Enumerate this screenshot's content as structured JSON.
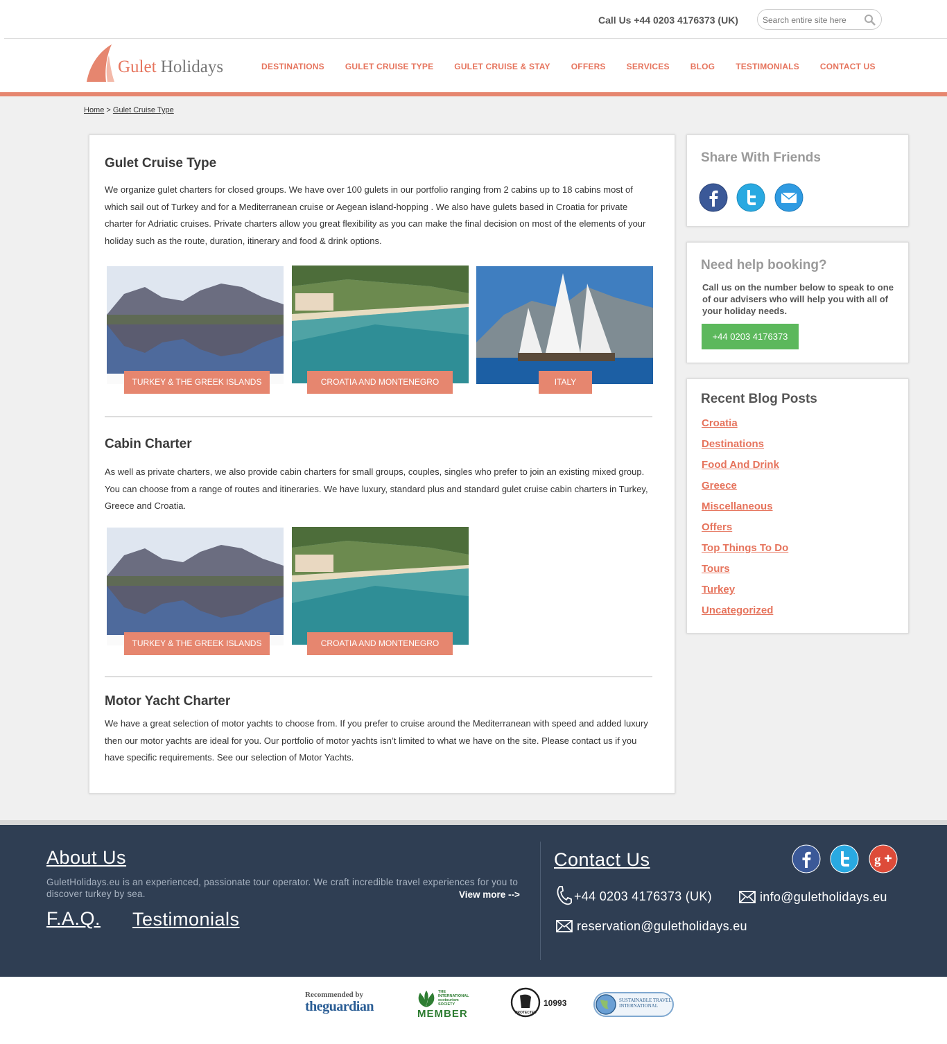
{
  "topbar": {
    "call": "Call Us +44 0203 4176373 (UK)",
    "search_placeholder": "Search entire site here"
  },
  "logo": {
    "brand_a": "Gulet",
    "brand_b": " Holidays"
  },
  "nav": [
    "DESTINATIONS",
    "GULET CRUISE TYPE",
    "GULET CRUISE & STAY",
    "OFFERS",
    "SERVICES",
    "BLOG",
    "TESTIMONIALS",
    "CONTACT US"
  ],
  "breadcrumb": {
    "home": "Home",
    "sep": " > ",
    "current": "Gulet Cruise Type"
  },
  "content": {
    "title": "Gulet Cruise Type",
    "intro": "We organize gulet charters for closed groups. We have over 100 gulets in our portfolio ranging from 2 cabins up to 18 cabins most of which sail out of Turkey and for a Mediterranean cruise or Aegean island-hopping . We also have gulets based in Croatia for private charter  for Adriatic cruises. Private charters allow you great flexibility as you can make the final decision on most of the elements of your holiday such as the route, duration, itinerary and food & drink options.",
    "tiles1": [
      "TURKEY & THE GREEK ISLANDS",
      "CROATIA AND MONTENEGRO",
      "ITALY"
    ],
    "cabin_title": "Cabin Charter",
    "cabin_text": "As well as private charters, we also provide cabin charters for small groups, couples, singles who prefer to join an existing mixed  group. You can choose from a range of routes and itineraries. We have luxury, standard plus and standard gulet cruise cabin charters in Turkey, Greece and Croatia.",
    "tiles2": [
      "TURKEY & THE GREEK ISLANDS",
      "CROATIA AND MONTENEGRO"
    ],
    "motor_title": "Motor Yacht Charter",
    "motor_text": "We have a great selection of motor yachts to choose from. If you prefer to cruise around the Mediterranean with speed and added luxury then our motor yachts are ideal for you. Our portfolio of motor yachts isn’t limited to what we have on the site. Please contact us if you have specific requirements. See our selection of Motor Yachts."
  },
  "sidebar": {
    "share_title": "Share With Friends",
    "help_title": "Need help booking?",
    "help_text": "Call us on the number below to speak to one of our advisers who will help you with all of your holiday needs.",
    "phone": "+44 0203 4176373",
    "blog_title": "Recent Blog Posts",
    "blog_items": [
      "Croatia",
      "Destinations",
      "Food And Drink",
      "Greece",
      "Miscellaneous",
      "Offers",
      "Top Things To Do",
      "Tours",
      "Turkey",
      "Uncategorized"
    ]
  },
  "footer": {
    "about_title": "About Us",
    "about_text": "GuletHolidays.eu is an experienced, passionate tour operator. We craft incredible travel experiences for you to discover turkey by sea.",
    "view_more": "View more -->",
    "faq": "F.A.Q.",
    "testimonials": "Testimonials",
    "contact_title": "Contact Us",
    "phone": "+44 0203 4176373 (UK)",
    "email1": "info@guletholidays.eu",
    "email2": "reservation@guletholidays.eu"
  },
  "badges": {
    "guardian_a": "Recommended by",
    "guardian_b": "theguardian",
    "ecotourism_a": "THE INTERNATIONAL ecotourism SOCIETY",
    "ecotourism_b": "MEMBER",
    "atol": "10993",
    "atol_small": "PROTECTED",
    "sti": "SUSTAINABLE TRAVEL INTERNATIONAL"
  },
  "colors": {
    "accent": "#e6745d",
    "footer": "#2f3e53",
    "green": "#5cb85c"
  }
}
